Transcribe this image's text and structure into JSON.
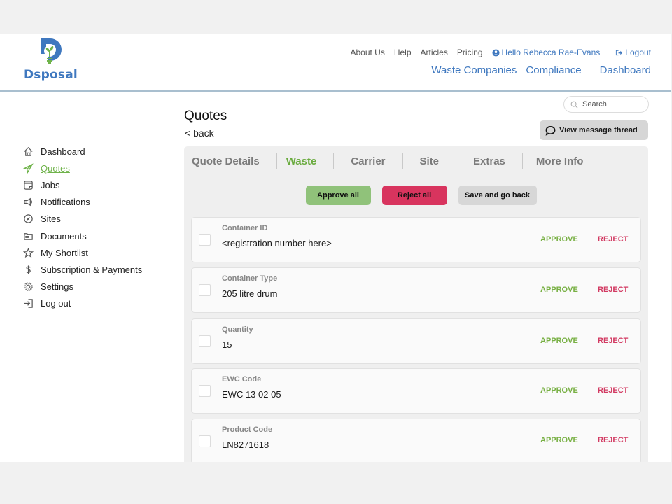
{
  "brand": {
    "name": "Dsposal",
    "colors": {
      "primary_blue": "#3f78bf",
      "leaf_green": "#6fb34a",
      "reject_red": "#d8345e",
      "approve_green": "#90c27a"
    }
  },
  "header": {
    "top_links": [
      "About Us",
      "Help",
      "Articles",
      "Pricing"
    ],
    "user_greeting": "Hello Rebecca Rae-Evans",
    "user_icon": "user-circle-icon",
    "logout_label": "Logout",
    "logout_icon": "logout-arrow-icon",
    "main_nav": [
      "Waste Companies",
      "Compliance",
      "Dashboard"
    ]
  },
  "sidebar": {
    "items": [
      {
        "label": "Dashboard",
        "icon": "home-icon",
        "active": false
      },
      {
        "label": "Quotes",
        "icon": "paper-plane-icon",
        "active": true
      },
      {
        "label": "Jobs",
        "icon": "wallet-icon",
        "active": false
      },
      {
        "label": "Notifications",
        "icon": "megaphone-icon",
        "active": false
      },
      {
        "label": "Sites",
        "icon": "compass-icon",
        "active": false
      },
      {
        "label": "Documents",
        "icon": "folder-icon",
        "active": false
      },
      {
        "label": "My Shortlist",
        "icon": "star-icon",
        "active": false
      },
      {
        "label": "Subscription & Payments",
        "icon": "dollar-icon",
        "active": false
      },
      {
        "label": "Settings",
        "icon": "gear-icon",
        "active": false
      },
      {
        "label": "Log out",
        "icon": "logout-icon",
        "active": false
      }
    ]
  },
  "page": {
    "title": "Quotes",
    "back_label": "< back",
    "search_placeholder": "Search",
    "message_button": "View message thread"
  },
  "tabs": [
    {
      "label": "Quote Details",
      "active": false
    },
    {
      "label": "Waste",
      "active": true
    },
    {
      "label": "Carrier",
      "active": false
    },
    {
      "label": "Site",
      "active": false
    },
    {
      "label": "Extras",
      "active": false
    },
    {
      "label": "More Info",
      "active": false
    }
  ],
  "actions": {
    "approve_all": "Approve all",
    "reject_all": "Reject all",
    "save_back": "Save and go back"
  },
  "row_actions": {
    "approve": "APPROVE",
    "reject": "REJECT"
  },
  "fields": [
    {
      "label": "Container ID",
      "value": "<registration number here>"
    },
    {
      "label": "Container Type",
      "value": "205 litre drum"
    },
    {
      "label": "Quantity",
      "value": "15"
    },
    {
      "label": "EWC Code",
      "value": "EWC 13 02 05"
    },
    {
      "label": "Product Code",
      "value": "LN8271618"
    }
  ]
}
